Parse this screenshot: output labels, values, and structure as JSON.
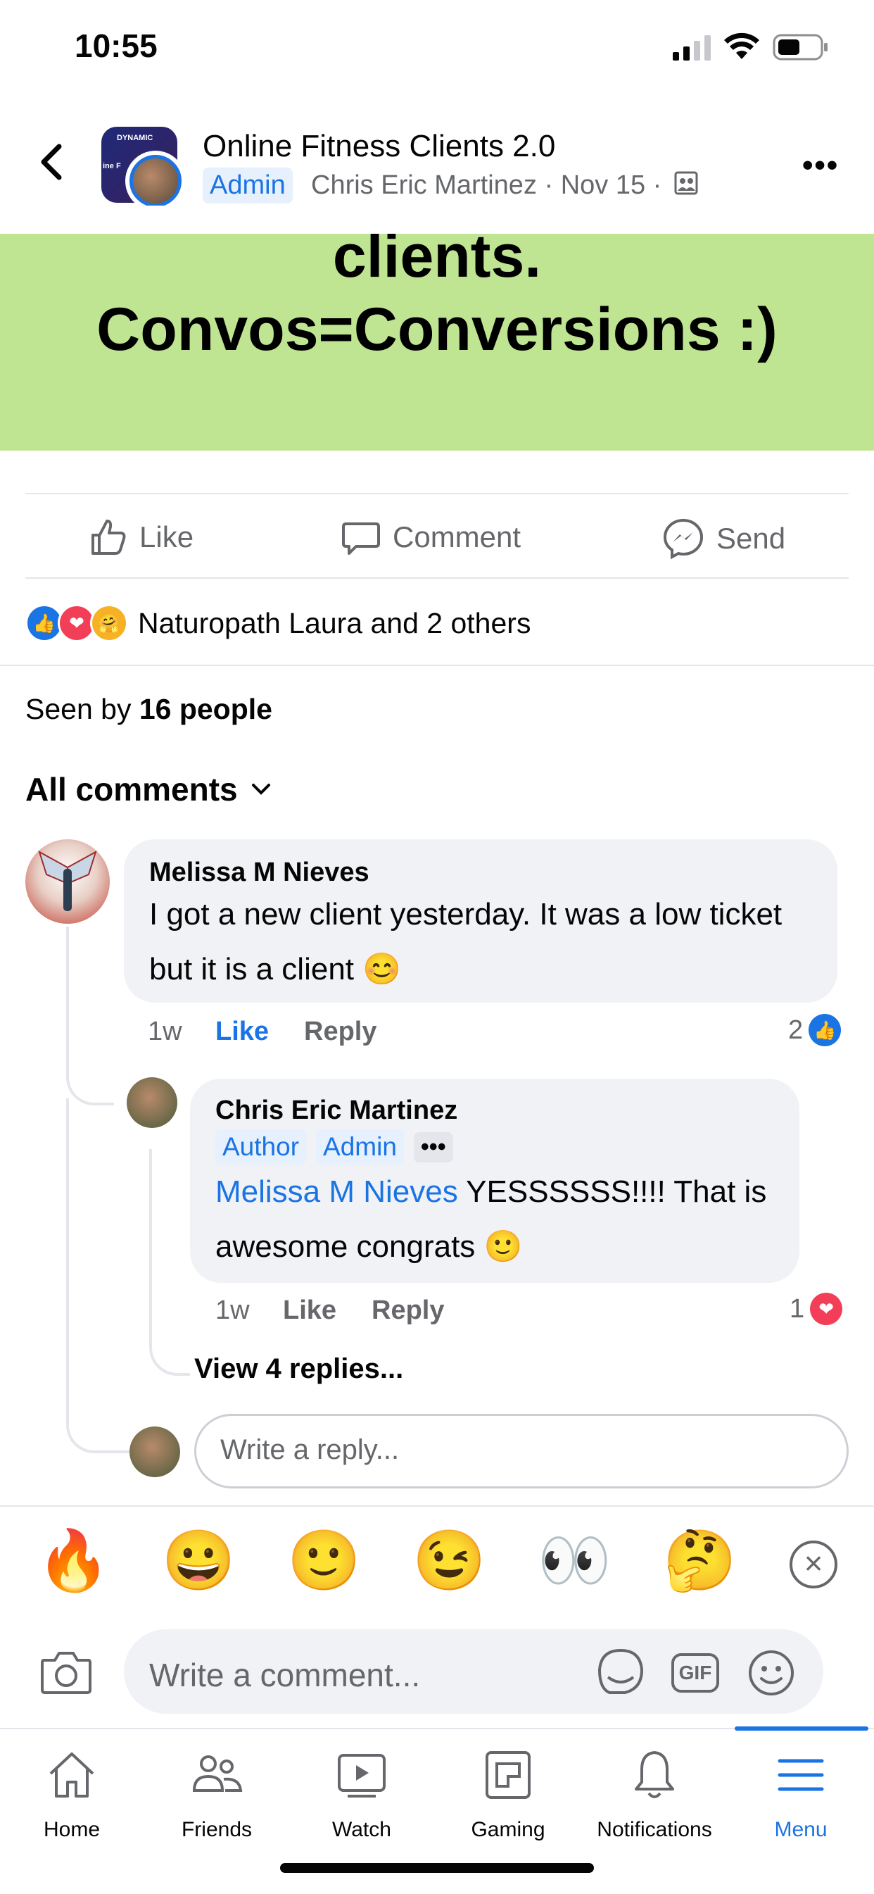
{
  "status": {
    "time": "10:55"
  },
  "header": {
    "group_name": "Online Fitness Clients 2.0",
    "badge": "Admin",
    "author": "Chris Eric Martinez",
    "date": "· Nov 15 ·",
    "thumb_text": "DYNAMIC",
    "thumb_text_2": "ine F"
  },
  "post": {
    "line1": "clients.",
    "line2": "Convos=Conversions :)"
  },
  "actions": {
    "like": "Like",
    "comment": "Comment",
    "send": "Send"
  },
  "reactions": {
    "summary": "Naturopath Laura and 2 others"
  },
  "seen": {
    "prefix": "Seen by ",
    "count": "16 people"
  },
  "comments_header": "All comments",
  "comment1": {
    "name": "Melissa M Nieves",
    "text_line1": "I got a new client yesterday. It was a low ticket",
    "text_line2": "but it is a client 😊",
    "time": "1w",
    "like": "Like",
    "reply": "Reply",
    "reaction_count": "2"
  },
  "reply1": {
    "name": "Chris Eric Martinez",
    "tag_author": "Author",
    "tag_admin": "Admin",
    "tag_more": "•••",
    "mention": "Melissa M Nieves",
    "text_line1_rest": " YESSSSSS!!!! That is",
    "text_line2": "awesome congrats 🙂",
    "time": "1w",
    "like": "Like",
    "reply": "Reply",
    "reaction_count": "1"
  },
  "view_replies": "View 4 replies...",
  "reply_input": {
    "placeholder": "Write a reply..."
  },
  "emoji_bar": [
    "🔥",
    "😀",
    "🙂",
    "😉",
    "👀",
    "🤔"
  ],
  "composer": {
    "placeholder": "Write a comment...",
    "gif": "GIF"
  },
  "tabs": [
    {
      "label": "Home"
    },
    {
      "label": "Friends"
    },
    {
      "label": "Watch"
    },
    {
      "label": "Gaming"
    },
    {
      "label": "Notifications"
    },
    {
      "label": "Menu"
    }
  ],
  "colors": {
    "accent": "#1b74e4",
    "post_bg": "#c0e592",
    "bubble": "#f0f2f5",
    "love": "#f33e58"
  }
}
